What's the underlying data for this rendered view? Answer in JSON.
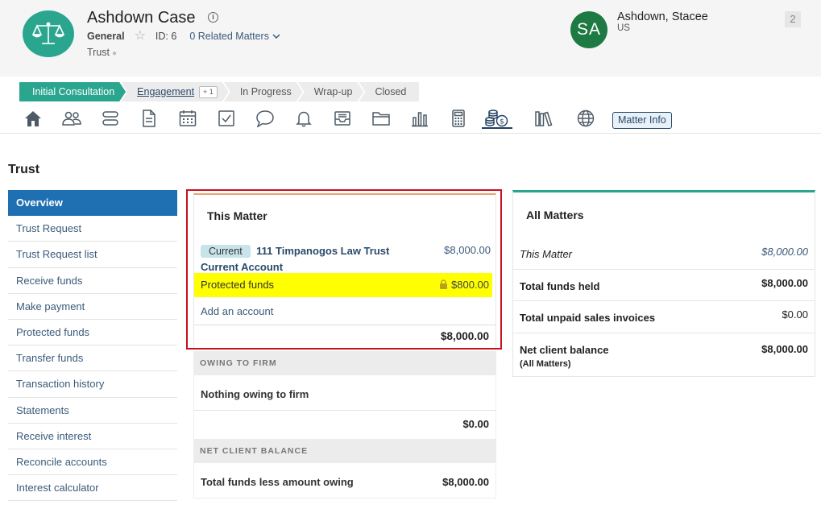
{
  "header": {
    "title": "Ashdown Case",
    "practice_area": "General",
    "id_label": "ID: 6",
    "related": "0 Related Matters",
    "subtype": "Trust",
    "user_initials": "SA",
    "user_name": "Ashdown, Stacee",
    "user_location": "US",
    "counter": "2",
    "colors": {
      "logo": "#2aa68f",
      "avatar": "#1e7a43"
    }
  },
  "stages": [
    {
      "label": "Initial Consultation"
    },
    {
      "label": "Engagement",
      "extra": "+ 1"
    },
    {
      "label": "In Progress"
    },
    {
      "label": "Wrap-up"
    },
    {
      "label": "Closed"
    }
  ],
  "toolbar": {
    "icons": [
      "home-icon",
      "people-icon",
      "cards-icon",
      "document-icon",
      "calendar-icon",
      "task-icon",
      "chat-icon",
      "bell-icon",
      "inbox-icon",
      "folder-icon",
      "chart-icon",
      "calculator-icon",
      "coins-icon",
      "library-icon",
      "globe-icon"
    ],
    "matter_info": "Matter Info"
  },
  "page": {
    "title": "Trust"
  },
  "sidenav": [
    "Overview",
    "Trust Request",
    "Trust Request list",
    "Receive funds",
    "Make payment",
    "Protected funds",
    "Transfer funds",
    "Transaction history",
    "Statements",
    "Receive interest",
    "Reconcile accounts",
    "Interest calculator"
  ],
  "this_matter": {
    "title": "This Matter",
    "badge": "Current",
    "account_line1": "111 Timpanogos Law Trust",
    "account_line2": "Current Account",
    "account_amount": "$8,000.00",
    "protected_label": "Protected funds",
    "protected_amount": "$800.00",
    "add_account": "Add an account",
    "total": "$8,000.00"
  },
  "owing": {
    "header": "OWING TO FIRM",
    "text": "Nothing owing to firm",
    "total": "$0.00"
  },
  "net_balance": {
    "header": "NET CLIENT BALANCE",
    "label": "Total funds less amount owing",
    "value": "$8,000.00"
  },
  "all_matters": {
    "title": "All Matters",
    "rows": [
      {
        "label": "This Matter",
        "value": "$8,000.00"
      },
      {
        "label": "Total funds held",
        "value": "$8,000.00"
      },
      {
        "label": "Total unpaid sales invoices",
        "value": "$0.00"
      },
      {
        "label": "Net client balance",
        "sublabel": "(All Matters)",
        "value": "$8,000.00"
      }
    ]
  }
}
